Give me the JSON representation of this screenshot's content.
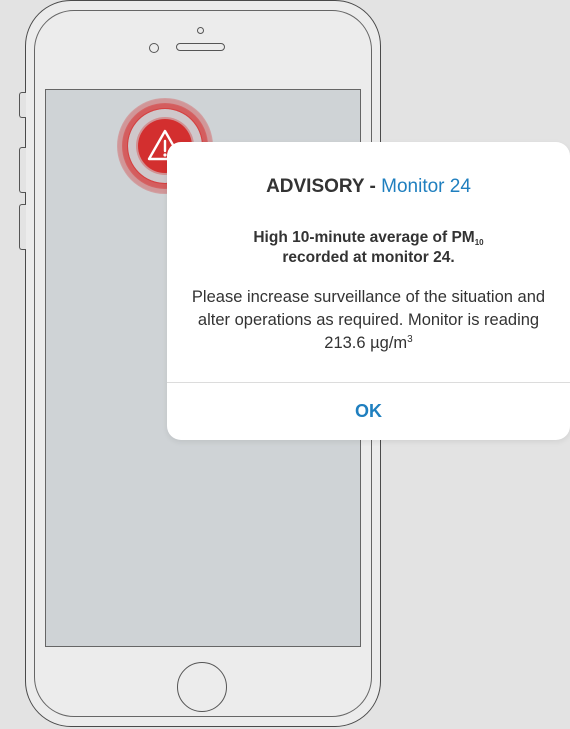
{
  "alert": {
    "icon": "warning-triangle-icon",
    "accent_color": "#d32f2f"
  },
  "dialog": {
    "title_prefix": "ADVISORY",
    "title_separator": " - ",
    "title_monitor": "Monitor 24",
    "headline_part1": "High 10-minute average of PM",
    "headline_subscript": "10",
    "headline_part2": "recorded at monitor 24.",
    "body_text": "Please increase surveillance of the situation and alter operations as required. Monitor is reading 213.6 µg/m",
    "body_superscript": "3",
    "ok_label": "OK",
    "accent_color": "#1f7fbf"
  }
}
